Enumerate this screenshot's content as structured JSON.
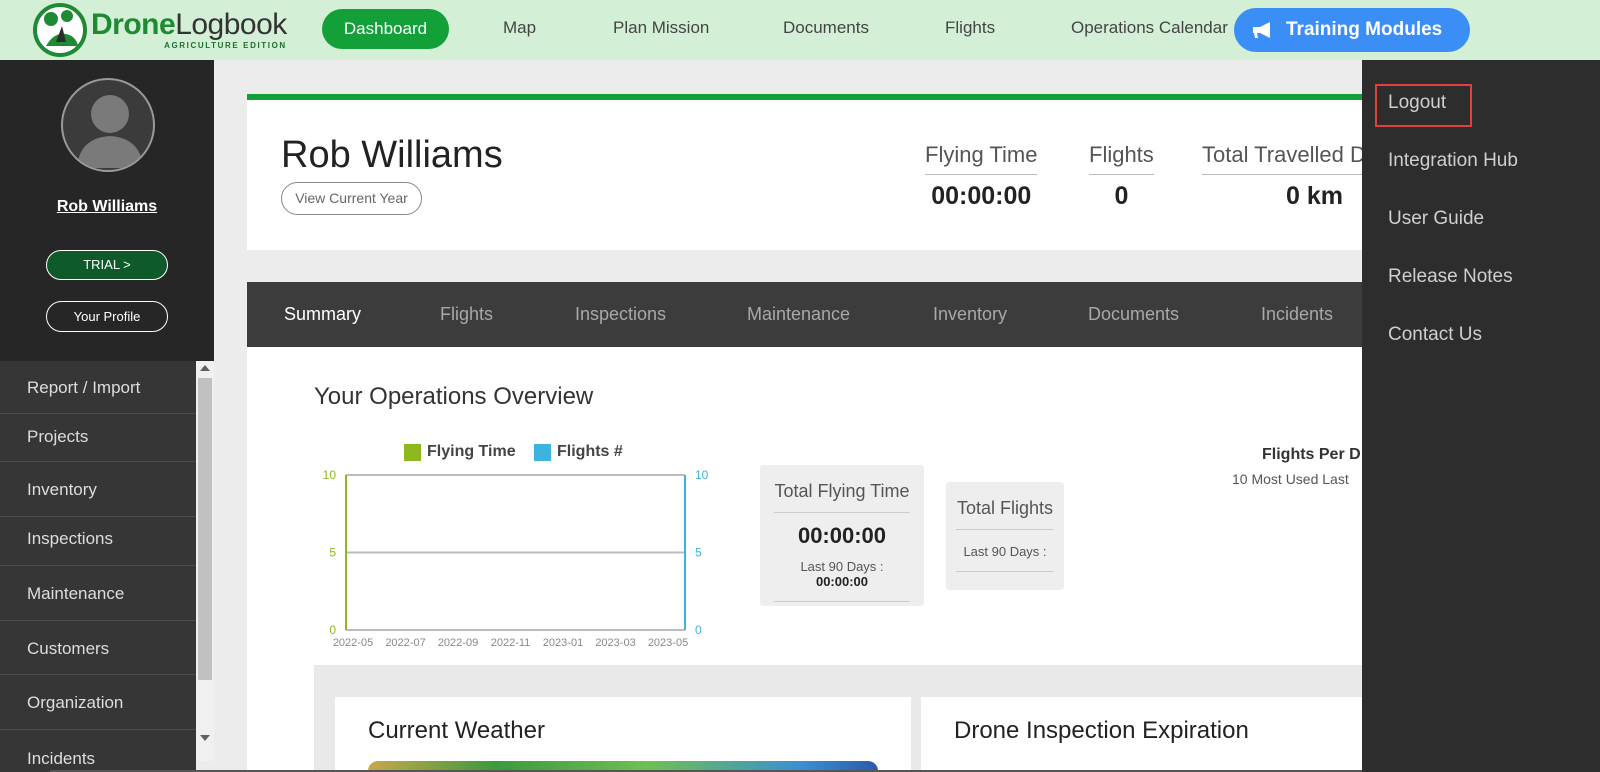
{
  "brand": {
    "name_part1": "Drone",
    "name_part2": "Logbook",
    "edition": "AGRICULTURE EDITION"
  },
  "nav": {
    "dashboard": "Dashboard",
    "map": "Map",
    "plan_mission": "Plan Mission",
    "documents": "Documents",
    "flights": "Flights",
    "operations_calendar": "Operations Calendar",
    "training": "Training Modules"
  },
  "sidebar": {
    "user_name": "Rob Williams",
    "trial_label": "TRIAL >",
    "profile_label": "Your Profile",
    "items": [
      {
        "label": "Report / Import"
      },
      {
        "label": "Projects"
      },
      {
        "label": "Inventory"
      },
      {
        "label": "Inspections"
      },
      {
        "label": "Maintenance"
      },
      {
        "label": "Customers"
      },
      {
        "label": "Organization"
      },
      {
        "label": "Incidents"
      }
    ]
  },
  "profile": {
    "name": "Rob Williams",
    "view_year_label": "View Current Year",
    "stats": [
      {
        "label": "Flying Time",
        "value": "00:00:00"
      },
      {
        "label": "Flights",
        "value": "0"
      },
      {
        "label": "Total Travelled D",
        "value": "0 km"
      }
    ]
  },
  "tabs": [
    {
      "label": "Summary"
    },
    {
      "label": "Flights"
    },
    {
      "label": "Inspections"
    },
    {
      "label": "Maintenance"
    },
    {
      "label": "Inventory"
    },
    {
      "label": "Documents"
    },
    {
      "label": "Incidents"
    }
  ],
  "overview": {
    "title": "Your Operations Overview",
    "legend": [
      {
        "name": "Flying Time",
        "color": "#8db81e"
      },
      {
        "name": "Flights #",
        "color": "#3fb3e0"
      }
    ],
    "total_flying_time": {
      "title": "Total Flying Time",
      "value": "00:00:00",
      "last90_label": "Last 90 Days :",
      "last90_value": "00:00:00"
    },
    "total_flights": {
      "title": "Total Flights",
      "last90_label": "Last 90 Days :"
    },
    "flights_per_title": "Flights Per D",
    "flights_per_sub": "10 Most Used Last"
  },
  "chart_data": {
    "type": "line",
    "x": [
      "2022-05",
      "2022-07",
      "2022-09",
      "2022-11",
      "2023-01",
      "2023-03",
      "2023-05"
    ],
    "series": [
      {
        "name": "Flying Time",
        "values": [],
        "color": "#8db81e",
        "axis": "left"
      },
      {
        "name": "Flights #",
        "values": [],
        "color": "#3fb3e0",
        "axis": "right"
      }
    ],
    "left_ticks": [
      "10",
      "5",
      "0"
    ],
    "right_ticks": [
      "10",
      "5",
      "0"
    ],
    "ylim": [
      0,
      10
    ],
    "grid": true
  },
  "cards": {
    "weather": "Current Weather",
    "inspection": "Drone Inspection Expiration"
  },
  "dropdown": {
    "items": [
      {
        "label": "Logout"
      },
      {
        "label": "Integration Hub"
      },
      {
        "label": "User Guide"
      },
      {
        "label": "Release Notes"
      },
      {
        "label": "Contact Us"
      }
    ],
    "highlight_color": "#e0413a"
  }
}
